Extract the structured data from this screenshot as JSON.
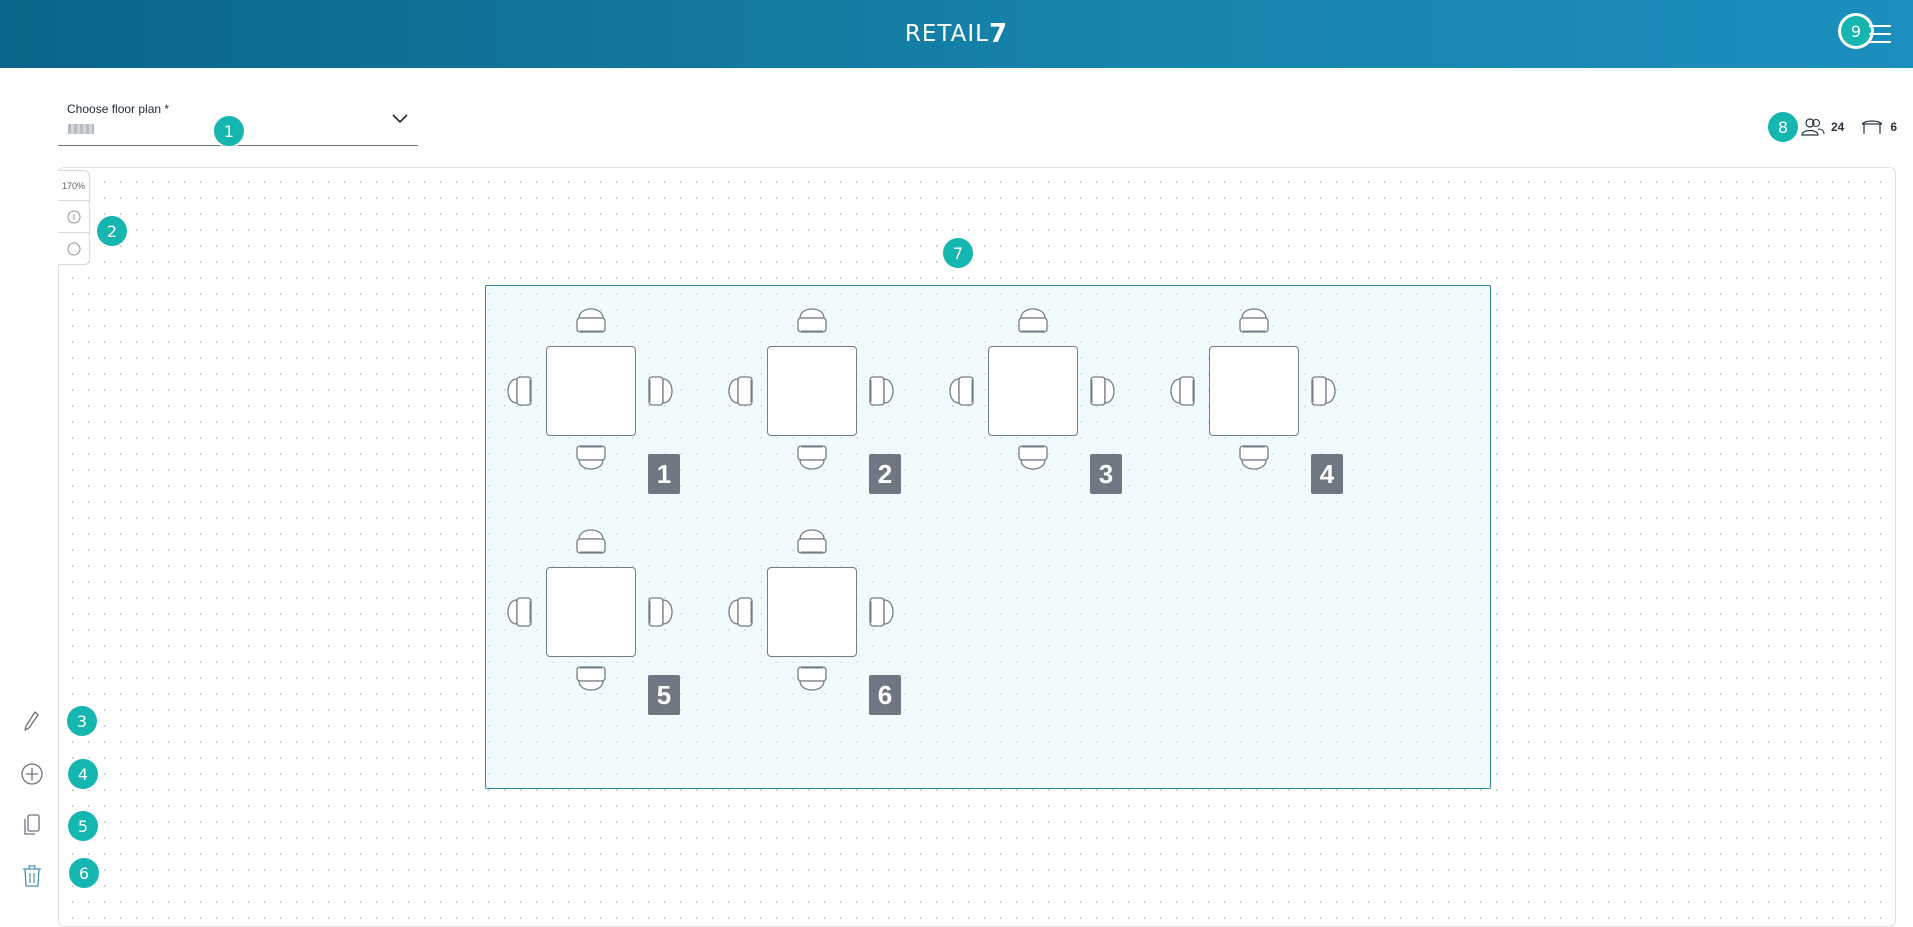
{
  "header": {
    "brand_text": "RETAIL",
    "brand_num": "7",
    "menu_badge": "9"
  },
  "floor_plan": {
    "label": "Choose floor plan *",
    "badge": "1"
  },
  "stats": {
    "badge": "8",
    "guests_count": "24",
    "tables_count": "6",
    "guests_icon": "people-icon",
    "tables_icon": "table-icon"
  },
  "zoom": {
    "level": "170%",
    "badge": "2"
  },
  "room": {
    "badge": "7"
  },
  "tables": [
    {
      "number": "1"
    },
    {
      "number": "2"
    },
    {
      "number": "3"
    },
    {
      "number": "4"
    },
    {
      "number": "5"
    },
    {
      "number": "6"
    }
  ],
  "tools": [
    {
      "icon": "pencil-icon",
      "badge": "3"
    },
    {
      "icon": "add-circle-icon",
      "badge": "4"
    },
    {
      "icon": "copy-icon",
      "badge": "5"
    },
    {
      "icon": "trash-icon",
      "badge": "6"
    }
  ],
  "colors": {
    "header_start": "#0b6588",
    "header_end": "#1b8fbd",
    "badge": "#15b5b0",
    "room_border": "#2e8aa5",
    "table_number_bg": "#6f7882"
  }
}
